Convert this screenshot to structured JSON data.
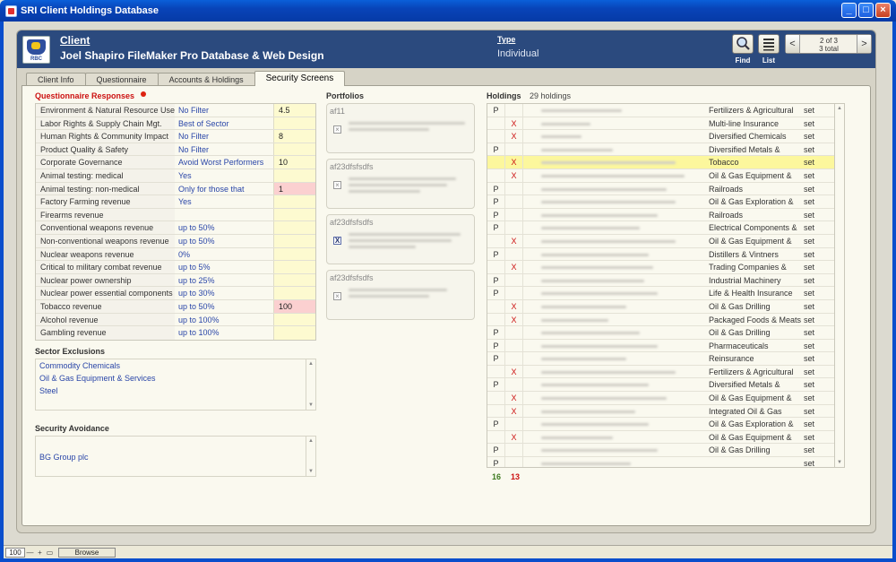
{
  "window": {
    "title": "SRI Client Holdings Database",
    "minimize": "_",
    "maximize": "□",
    "close": "×"
  },
  "header": {
    "logo_text": "RBC",
    "client_label": "Client",
    "client_name": "Joel Shapiro FileMaker Pro Database & Web Design",
    "type_label": "Type",
    "type_value": "Individual",
    "find_label": "Find",
    "list_label": "List",
    "record_position": "2 of 3",
    "record_total": "3 total",
    "prev_arrow": "<",
    "next_arrow": ">"
  },
  "tabs": [
    {
      "label": "Client Info",
      "active": false
    },
    {
      "label": "Questionnaire",
      "active": false
    },
    {
      "label": "Accounts & Holdings",
      "active": false
    },
    {
      "label": "Security Screens",
      "active": true
    }
  ],
  "questionnaire": {
    "title": "Questionnaire Responses",
    "rows": [
      {
        "label": "Environment & Natural Resource Use",
        "filter": "No Filter",
        "score": "4.5",
        "highlight": false
      },
      {
        "label": "Labor Rights & Supply Chain Mgt.",
        "filter": "Best of Sector",
        "score": "",
        "highlight": false
      },
      {
        "label": "Human Rights & Community Impact",
        "filter": "No Filter",
        "score": "8",
        "highlight": false
      },
      {
        "label": "Product Quality & Safety",
        "filter": "No Filter",
        "score": "",
        "highlight": false
      },
      {
        "label": "Corporate Governance",
        "filter": "Avoid Worst Performers",
        "score": "10",
        "highlight": false
      },
      {
        "label": "Animal testing: medical",
        "filter": "Yes",
        "score": "",
        "highlight": false
      },
      {
        "label": "Animal testing: non-medical",
        "filter": "Only for those that",
        "score": "1",
        "highlight": true
      },
      {
        "label": "Factory Farming revenue",
        "filter": "Yes",
        "score": "",
        "highlight": false
      },
      {
        "label": "Firearms revenue",
        "filter": "",
        "score": "",
        "highlight": false
      },
      {
        "label": "Conventional weapons revenue",
        "filter": "up to 50%",
        "score": "",
        "highlight": false
      },
      {
        "label": "Non-conventional weapons revenue",
        "filter": "up to 50%",
        "score": "",
        "highlight": false
      },
      {
        "label": "Nuclear weapons revenue",
        "filter": "0%",
        "score": "",
        "highlight": false
      },
      {
        "label": "Critical to military combat revenue",
        "filter": "up to 5%",
        "score": "",
        "highlight": false
      },
      {
        "label": "Nuclear power ownership",
        "filter": "up to 25%",
        "score": "",
        "highlight": false
      },
      {
        "label": "Nuclear power essential components",
        "filter": "up to 30%",
        "score": "",
        "highlight": false
      },
      {
        "label": "Tobacco revenue",
        "filter": "up to 50%",
        "score": "100",
        "highlight": true
      },
      {
        "label": "Alcohol revenue",
        "filter": "up to 100%",
        "score": "",
        "highlight": false
      },
      {
        "label": "Gambling revenue",
        "filter": "up to 100%",
        "score": "",
        "highlight": false
      }
    ]
  },
  "sector_exclusions": {
    "title": "Sector Exclusions",
    "items": [
      "Commodity Chemicals",
      "Oil & Gas Equipment & Services",
      "Steel"
    ]
  },
  "security_avoidance": {
    "title": "Security Avoidance",
    "items": [
      "BG Group plc"
    ]
  },
  "portfolios": {
    "title": "Portfolios",
    "items": [
      {
        "name": "af11",
        "checked": false
      },
      {
        "name": "af23dfsfsdfs",
        "checked": false
      },
      {
        "name": "af23dfsfsdfs",
        "checked": true
      },
      {
        "name": "af23dfsfsdfs",
        "checked": false
      }
    ],
    "check_mark": "X"
  },
  "holdings": {
    "title": "Holdings",
    "count_label": "29 holdings",
    "set_label": "set",
    "rows": [
      {
        "p": "P",
        "x": "",
        "sector": "Fertilizers & Agricultural",
        "highlight": false
      },
      {
        "p": "",
        "x": "X",
        "sector": "Multi-line Insurance",
        "highlight": false
      },
      {
        "p": "",
        "x": "X",
        "sector": "Diversified Chemicals",
        "highlight": false
      },
      {
        "p": "P",
        "x": "",
        "sector": "Diversified Metals &",
        "highlight": false
      },
      {
        "p": "",
        "x": "X",
        "sector": "Tobacco",
        "highlight": true
      },
      {
        "p": "",
        "x": "X",
        "sector": "Oil & Gas Equipment &",
        "highlight": false
      },
      {
        "p": "P",
        "x": "",
        "sector": "Railroads",
        "highlight": false
      },
      {
        "p": "P",
        "x": "",
        "sector": "Oil & Gas Exploration &",
        "highlight": false
      },
      {
        "p": "P",
        "x": "",
        "sector": "Railroads",
        "highlight": false
      },
      {
        "p": "P",
        "x": "",
        "sector": "Electrical Components &",
        "highlight": false
      },
      {
        "p": "",
        "x": "X",
        "sector": "Oil & Gas Equipment &",
        "highlight": false
      },
      {
        "p": "P",
        "x": "",
        "sector": "Distillers & Vintners",
        "highlight": false
      },
      {
        "p": "",
        "x": "X",
        "sector": "Trading Companies &",
        "highlight": false
      },
      {
        "p": "P",
        "x": "",
        "sector": "Industrial Machinery",
        "highlight": false
      },
      {
        "p": "P",
        "x": "",
        "sector": "Life & Health Insurance",
        "highlight": false
      },
      {
        "p": "",
        "x": "X",
        "sector": "Oil & Gas Drilling",
        "highlight": false
      },
      {
        "p": "",
        "x": "X",
        "sector": "Packaged Foods & Meats",
        "highlight": false
      },
      {
        "p": "P",
        "x": "",
        "sector": "Oil & Gas Drilling",
        "highlight": false
      },
      {
        "p": "P",
        "x": "",
        "sector": "Pharmaceuticals",
        "highlight": false
      },
      {
        "p": "P",
        "x": "",
        "sector": "Reinsurance",
        "highlight": false
      },
      {
        "p": "",
        "x": "X",
        "sector": "Fertilizers & Agricultural",
        "highlight": false
      },
      {
        "p": "P",
        "x": "",
        "sector": "Diversified Metals &",
        "highlight": false
      },
      {
        "p": "",
        "x": "X",
        "sector": "Oil & Gas Equipment &",
        "highlight": false
      },
      {
        "p": "",
        "x": "X",
        "sector": "Integrated Oil & Gas",
        "highlight": false
      },
      {
        "p": "P",
        "x": "",
        "sector": "Oil & Gas Exploration &",
        "highlight": false
      },
      {
        "p": "",
        "x": "X",
        "sector": "Oil & Gas Equipment &",
        "highlight": false
      },
      {
        "p": "P",
        "x": "",
        "sector": "Oil & Gas Drilling",
        "highlight": false
      },
      {
        "p": "P",
        "x": "",
        "sector": "",
        "highlight": false
      }
    ],
    "count_passed": "16",
    "count_excluded": "13"
  },
  "statusbar": {
    "zoom": "100",
    "zoom_out": "—",
    "zoom_in": "+",
    "mode": "Browse"
  },
  "colors": {
    "header_bg": "#2b4a7e",
    "filter_text": "#2a46a8",
    "excluded": "#cc1111",
    "passed": "#3d7a1f",
    "highlight_row": "#fcf79d",
    "score_cell": "#fdfad0",
    "score_flag": "#fbd0d0"
  }
}
